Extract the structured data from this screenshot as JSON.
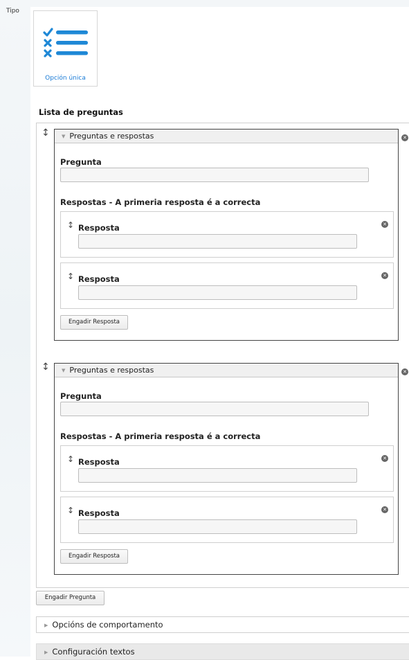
{
  "tipo": {
    "label": "Tipo",
    "option_label": "Opción única",
    "icon": "checklist-icon"
  },
  "list": {
    "title": "Lista de preguntas",
    "questions": [
      {
        "header": "Preguntas e respostas",
        "question_label": "Pregunta",
        "question_value": "",
        "answers_label": "Respostas - A primeria resposta é a correcta",
        "answers": [
          {
            "label": "Resposta",
            "value": ""
          },
          {
            "label": "Resposta",
            "value": ""
          }
        ],
        "add_answer": "Engadir Resposta"
      },
      {
        "header": "Preguntas e respostas",
        "question_label": "Pregunta",
        "question_value": "",
        "answers_label": "Respostas - A primeria resposta é a correcta",
        "answers": [
          {
            "label": "Resposta",
            "value": ""
          },
          {
            "label": "Resposta",
            "value": ""
          }
        ],
        "add_answer": "Engadir Resposta"
      }
    ],
    "add_question": "Engadir Pregunta"
  },
  "sections": [
    {
      "label": "Opcións de comportamento",
      "state": "collapsed"
    },
    {
      "label": "Configuración textos",
      "state": "collapsed"
    }
  ],
  "colors": {
    "accent": "#1a7bd6",
    "icon_blue": "#1e88d6"
  },
  "icons": {
    "drag": "↕",
    "remove": "×",
    "collapsed": "▶",
    "expanded": "▼"
  }
}
